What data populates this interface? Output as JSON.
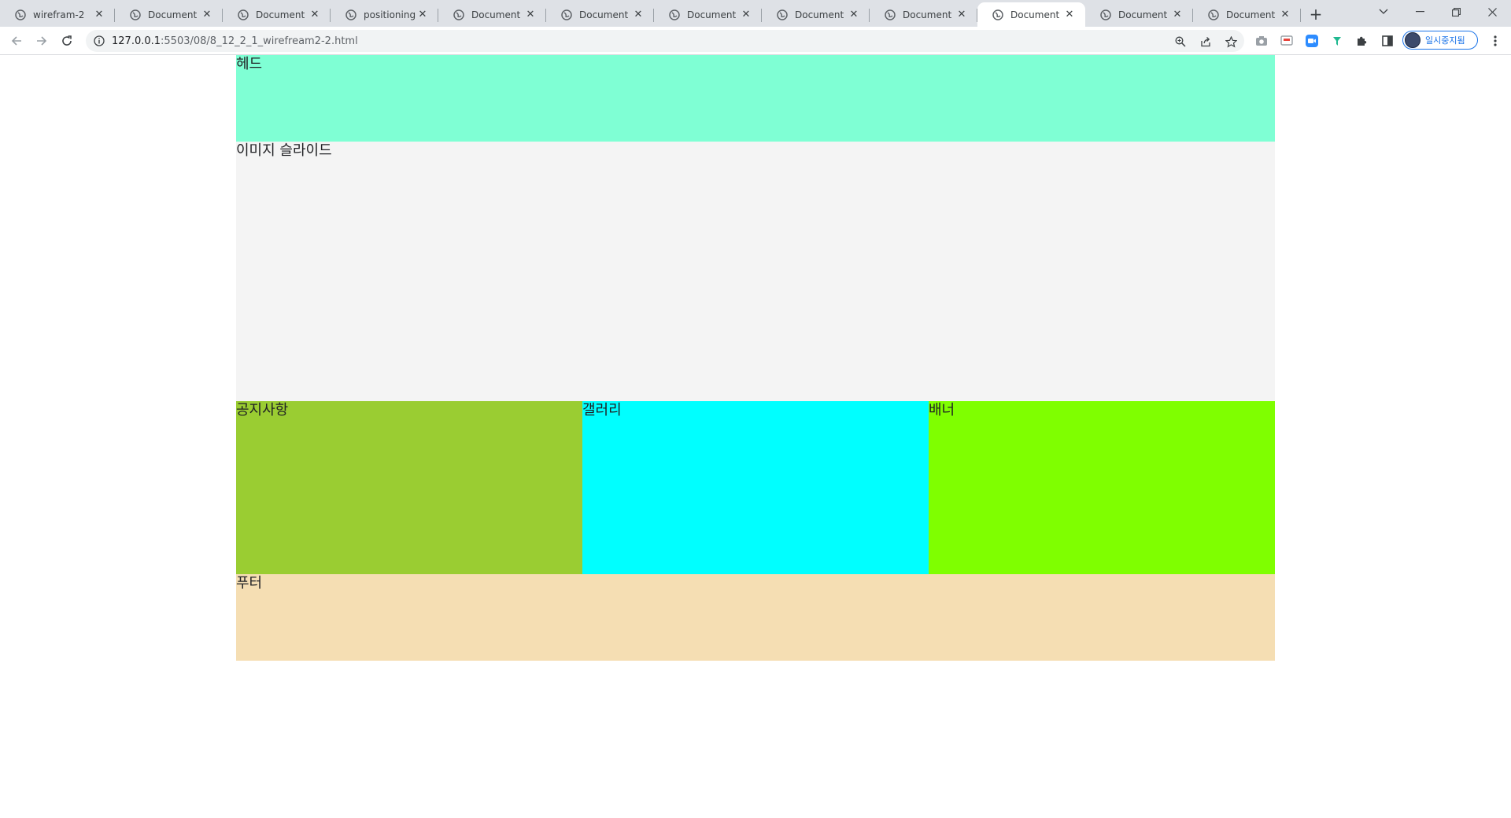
{
  "browser": {
    "tabs": [
      {
        "title": "wirefram-2",
        "active": false
      },
      {
        "title": "Document",
        "active": false
      },
      {
        "title": "Document",
        "active": false
      },
      {
        "title": "positioning",
        "active": false
      },
      {
        "title": "Document",
        "active": false
      },
      {
        "title": "Document",
        "active": false
      },
      {
        "title": "Document",
        "active": false
      },
      {
        "title": "Document",
        "active": false
      },
      {
        "title": "Document",
        "active": false
      },
      {
        "title": "Document",
        "active": true
      },
      {
        "title": "Document",
        "active": false
      },
      {
        "title": "Document",
        "active": false
      }
    ],
    "url_host": "127.0.0.1",
    "url_rest": ":5503/08/8_12_2_1_wirefream2-2.html",
    "profile_label": "일시중지됨",
    "colors": {
      "tabstrip": "#dee1e6",
      "accent": "#1a73e8"
    }
  },
  "wireframe": {
    "head": {
      "label": "헤드",
      "color": "#7fffd4"
    },
    "slide": {
      "label": "이미지 슬라이드",
      "color": "#f4f4f4"
    },
    "notice": {
      "label": "공지사항",
      "color": "#9acd32"
    },
    "gallery": {
      "label": "갤러리",
      "color": "#00ffff"
    },
    "banner": {
      "label": "배너",
      "color": "#7fff00"
    },
    "footer": {
      "label": "푸터",
      "color": "#f5deb3"
    }
  }
}
